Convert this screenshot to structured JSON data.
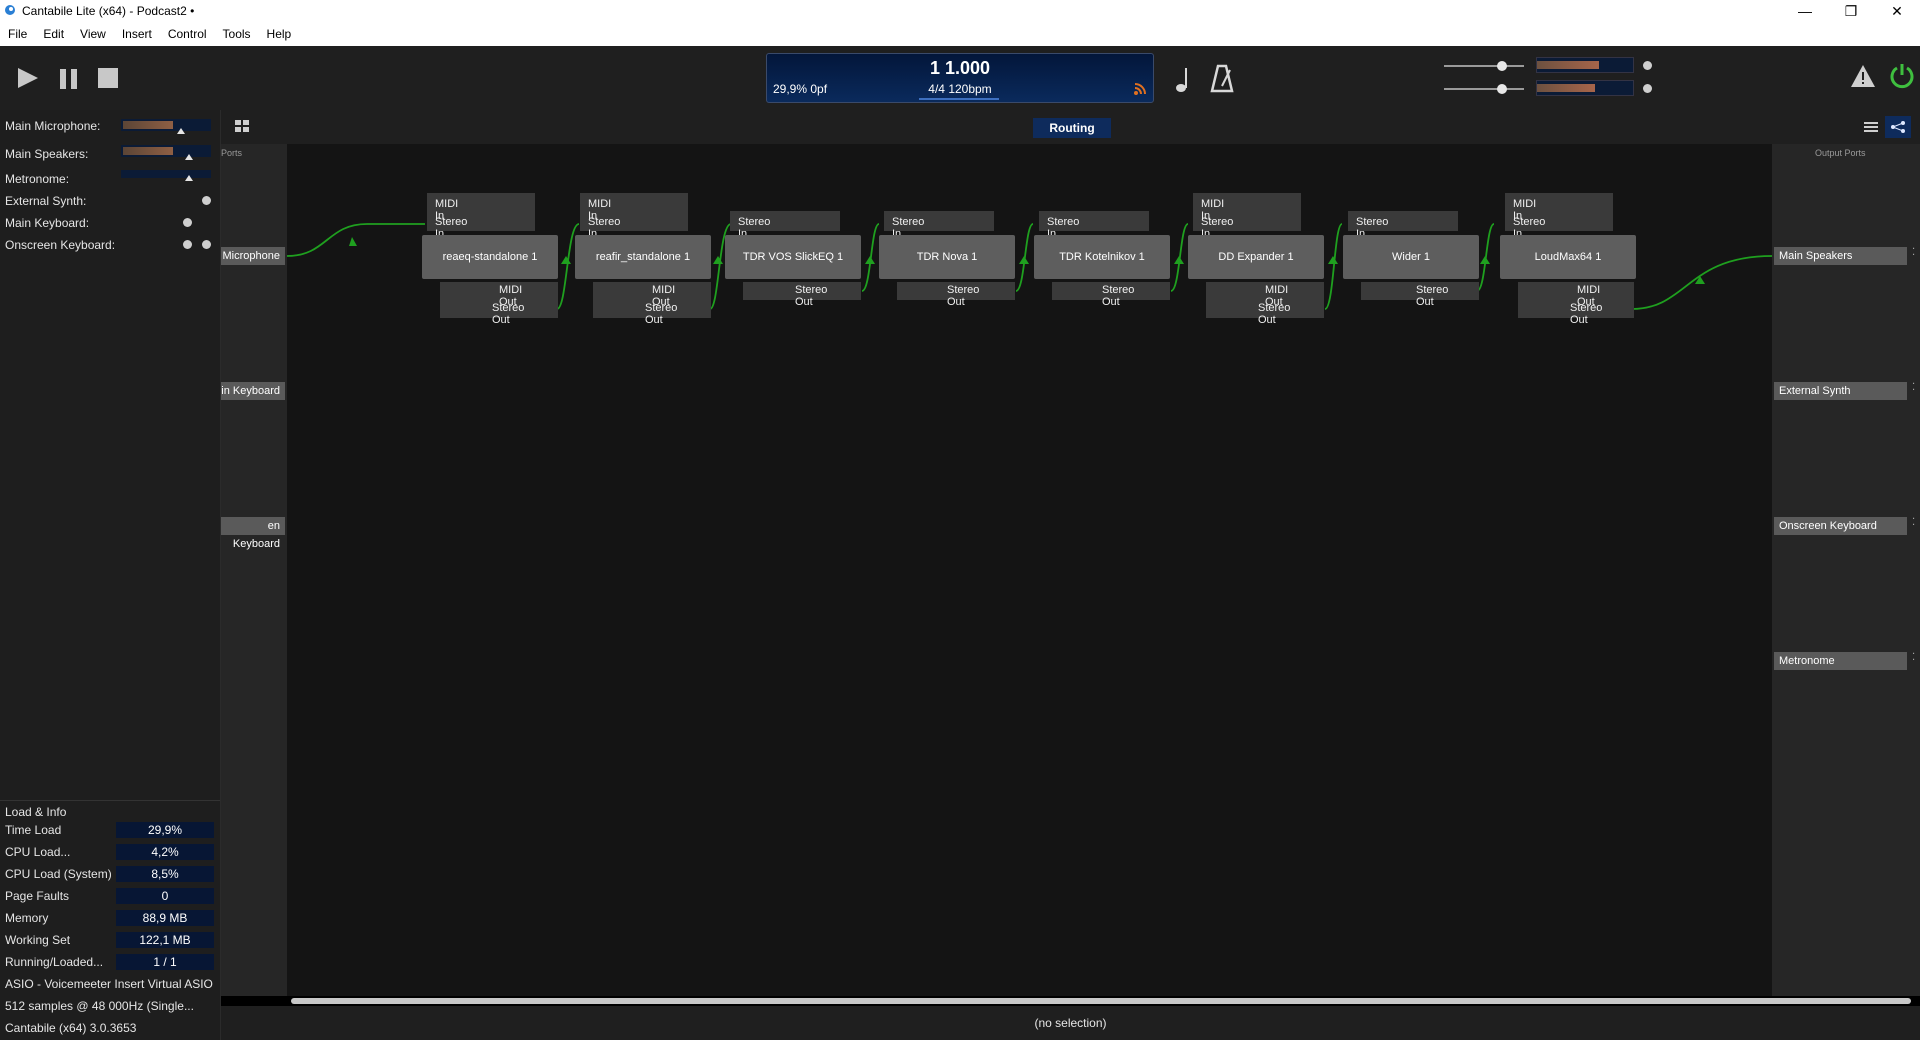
{
  "window": {
    "title": "Cantabile Lite (x64) - Podcast2 •",
    "app_icon": "cantabile-icon",
    "buttons": [
      "minimize-icon",
      "restore-icon",
      "close-icon"
    ]
  },
  "menu": [
    "File",
    "Edit",
    "View",
    "Insert",
    "Control",
    "Tools",
    "Help"
  ],
  "toolbar": {
    "transport": [
      "play-icon",
      "pause-icon",
      "stop-icon"
    ],
    "display": {
      "position": "1 1.000",
      "load": "29,9%  0pf",
      "tempo": "4/4 120bpm"
    },
    "note_icon": "note-icon",
    "metronome_icon": "metronome-icon",
    "warning_icon": "warning-icon",
    "power_icon": "power-icon",
    "accent": "#3fbf3f"
  },
  "levels": [
    {
      "name": "Main Microphone:"
    },
    {
      "name": "Main Speakers:"
    },
    {
      "name": "Metronome:"
    },
    {
      "name": "External Synth:"
    },
    {
      "name": "Main Keyboard:"
    },
    {
      "name": "Onscreen Keyboard:"
    }
  ],
  "load_info": {
    "heading": "Load & Info",
    "rows": [
      {
        "label": "Time Load",
        "value": "29,9%"
      },
      {
        "label": "CPU Load...",
        "value": "4,2%"
      },
      {
        "label": "CPU Load (System)",
        "value": "8,5%"
      },
      {
        "label": "Page Faults",
        "value": "0"
      },
      {
        "label": "Memory",
        "value": "88,9 MB"
      },
      {
        "label": "Working Set",
        "value": "122,1 MB"
      },
      {
        "label": "Running/Loaded...",
        "value": "1 / 1"
      }
    ],
    "footer": [
      "ASIO - Voicemeeter Insert Virtual ASIO",
      "512 samples @ 48 000Hz (Single...",
      "Cantabile (x64) 3.0.3653"
    ]
  },
  "routing": {
    "tab": "Routing",
    "input_ports_label": "Ports",
    "output_ports_label": "Output Ports",
    "view_icons": [
      "list-view-icon",
      "routing-view-icon"
    ],
    "grid_icon": "grid-icon",
    "input_ports": [
      "Microphone",
      "in Keyboard",
      "en Keyboard"
    ],
    "output_ports": [
      "Main Speakers",
      "External Synth",
      "Onscreen Keyboard",
      "Metronome"
    ],
    "plugins": [
      {
        "name": "reaeq-standalone 1",
        "ins": [
          "MIDI In",
          "Stereo In"
        ],
        "outs": [
          "MIDI Out",
          "Stereo Out"
        ]
      },
      {
        "name": "reafir_standalone 1",
        "ins": [
          "MIDI In",
          "Stereo In"
        ],
        "outs": [
          "MIDI Out",
          "Stereo Out"
        ]
      },
      {
        "name": "TDR VOS SlickEQ 1",
        "ins": [
          "Stereo In"
        ],
        "outs": [
          "Stereo Out"
        ]
      },
      {
        "name": "TDR Nova 1",
        "ins": [
          "Stereo In"
        ],
        "outs": [
          "Stereo Out"
        ]
      },
      {
        "name": "TDR Kotelnikov 1",
        "ins": [
          "Stereo In"
        ],
        "outs": [
          "Stereo Out"
        ]
      },
      {
        "name": "DD Expander 1",
        "ins": [
          "MIDI In",
          "Stereo In"
        ],
        "outs": [
          "MIDI Out",
          "Stereo Out"
        ]
      },
      {
        "name": "Wider 1",
        "ins": [
          "Stereo In"
        ],
        "outs": [
          "Stereo Out"
        ]
      },
      {
        "name": "LoudMax64 1",
        "ins": [
          "MIDI In",
          "Stereo In"
        ],
        "outs": [
          "MIDI Out",
          "Stereo Out"
        ]
      }
    ],
    "wire_color": "#1fa01f"
  },
  "status": "(no selection)"
}
